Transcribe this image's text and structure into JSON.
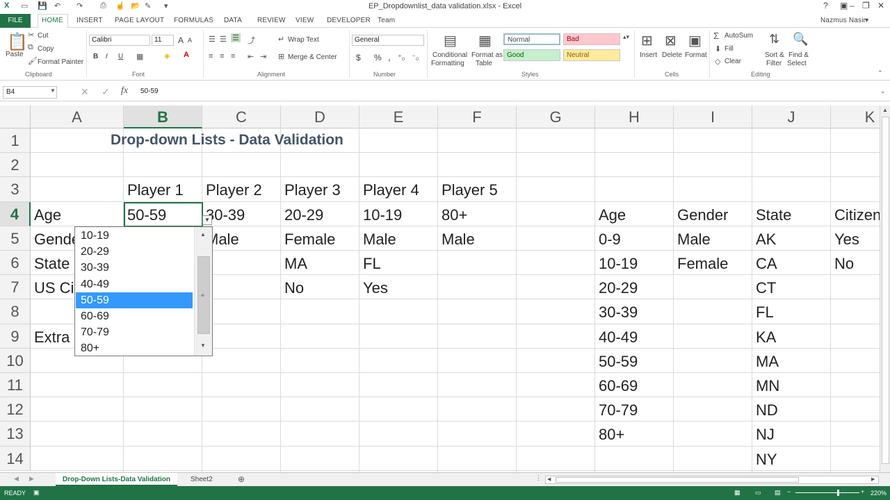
{
  "window": {
    "title": "EP_Dropdownlist_data validation.xlsx - Excel",
    "help": "?",
    "minimize": "–",
    "restore": "❐",
    "close": "✕",
    "qat_icons": [
      "excel-icon",
      "save-icon",
      "undo-icon",
      "redo-icon",
      "print-icon",
      "touch-icon",
      "open-icon",
      "form-icon",
      "more-icon"
    ]
  },
  "tabs": [
    "FILE",
    "HOME",
    "INSERT",
    "PAGE LAYOUT",
    "FORMULAS",
    "DATA",
    "REVIEW",
    "VIEW",
    "DEVELOPER",
    "Team"
  ],
  "user": "Nazmus Nasir",
  "ribbon": {
    "clipboard": {
      "paste": "Paste",
      "cut": "Cut",
      "copy": "Copy",
      "format_painter": "Format Painter",
      "group": "Clipboard"
    },
    "font": {
      "name": "Calibri",
      "size": "11",
      "bold": "B",
      "italic": "I",
      "underline": "U",
      "group": "Font",
      "grow": "A",
      "shrink": "A"
    },
    "alignment": {
      "wrap": "Wrap Text",
      "merge": "Merge & Center",
      "group": "Alignment"
    },
    "number": {
      "format": "General",
      "currency": "$",
      "percent": "%",
      "comma": ",",
      "group": "Number"
    },
    "styles": {
      "conditional": "Conditional",
      "conditional2": "Formatting",
      "format_as": "Format as",
      "format_as2": "Table",
      "normal": "Normal",
      "bad": "Bad",
      "good": "Good",
      "neutral": "Neutral",
      "group": "Styles"
    },
    "cells": {
      "insert": "Insert",
      "delete": "Delete",
      "format": "Format",
      "group": "Cells"
    },
    "editing": {
      "autosum": "AutoSum",
      "fill": "Fill",
      "clear": "Clear",
      "sort": "Sort &",
      "sort2": "Filter",
      "find": "Find &",
      "find2": "Select",
      "group": "Editing"
    }
  },
  "formula_bar": {
    "name_box": "B4",
    "fx": "fx",
    "value": "50-59"
  },
  "columns": [
    "A",
    "B",
    "C",
    "D",
    "E",
    "F",
    "G",
    "H",
    "I",
    "J",
    "K"
  ],
  "rows": [
    "1",
    "2",
    "3",
    "4",
    "5",
    "6",
    "7",
    "8",
    "9",
    "10",
    "11",
    "12",
    "13",
    "14"
  ],
  "sheet_title": "Drop-down Lists - Data Validation",
  "cells": {
    "B3": "Player 1",
    "C3": "Player 2",
    "D3": "Player 3",
    "E3": "Player 4",
    "F3": "Player 5",
    "A4": "Age",
    "B4": "50-59",
    "C4": "30-39",
    "D4": "20-29",
    "E4": "10-19",
    "F4": "80+",
    "A5": "Gende",
    "C5": "Male",
    "D5": "Female",
    "E5": "Male",
    "F5": "Male",
    "A6": "State",
    "D6": "MA",
    "E6": "FL",
    "A7": "US Cit",
    "D7": "No",
    "E7": "Yes",
    "A9": "Extra",
    "H4": "Age",
    "I4": "Gender",
    "J4": "State",
    "K4": "Citizen",
    "H5": "0-9",
    "I5": "Male",
    "J5": "AK",
    "K5": "Yes",
    "H6": "10-19",
    "I6": "Female",
    "J6": "CA",
    "K6": "No",
    "H7": "20-29",
    "J7": "CT",
    "H8": "30-39",
    "J8": "FL",
    "H9": "40-49",
    "J9": "KA",
    "H10": "50-59",
    "J10": "MA",
    "H11": "60-69",
    "J11": "MN",
    "H12": "70-79",
    "J12": "ND",
    "H13": "80+",
    "J13": "NJ",
    "J14": "NY"
  },
  "dropdown": {
    "items": [
      "10-19",
      "20-29",
      "30-39",
      "40-49",
      "50-59",
      "60-69",
      "70-79",
      "80+"
    ],
    "selected": "50-59"
  },
  "sheets": [
    "Drop-Down Lists-Data Validation",
    "Sheet2"
  ],
  "status": {
    "ready": "READY",
    "zoom": "220%"
  },
  "colors": {
    "accent": "#217346",
    "selection": "#3399ff",
    "title": "#44546a"
  }
}
